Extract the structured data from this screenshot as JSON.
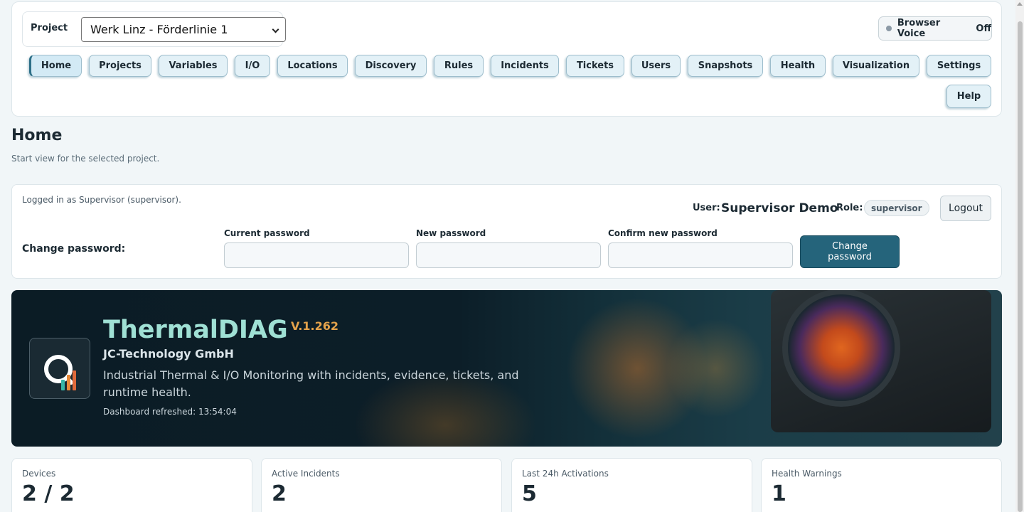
{
  "header": {
    "project_label": "Project",
    "project_value": "Werk Linz - Förderlinie 1",
    "voice_label": "Browser Voice",
    "voice_state": "Off"
  },
  "nav": {
    "items": [
      {
        "label": "Home"
      },
      {
        "label": "Projects"
      },
      {
        "label": "Variables"
      },
      {
        "label": "I/O"
      },
      {
        "label": "Locations"
      },
      {
        "label": "Discovery"
      },
      {
        "label": "Rules"
      },
      {
        "label": "Incidents"
      },
      {
        "label": "Tickets"
      },
      {
        "label": "Users"
      },
      {
        "label": "Snapshots"
      },
      {
        "label": "Health"
      },
      {
        "label": "Visualization"
      },
      {
        "label": "Settings"
      },
      {
        "label": "Help"
      }
    ],
    "active": "Home"
  },
  "page": {
    "title": "Home",
    "subtitle": "Start view for the selected project."
  },
  "account": {
    "logged_in_text": "Logged in as Supervisor (supervisor).",
    "user_label": "User:",
    "user_name": "Supervisor Demo",
    "role_label": "Role:",
    "role_value": "supervisor",
    "logout_label": "Logout",
    "change_password_label": "Change password:",
    "current_password_label": "Current password",
    "new_password_label": "New password",
    "confirm_password_label": "Confirm new password",
    "change_password_button_line1": "Change",
    "change_password_button_line2": "password"
  },
  "hero": {
    "title": "ThermalDIAG",
    "version": "V.1.262",
    "company": "JC-Technology GmbH",
    "description": "Industrial Thermal & I/O Monitoring with incidents, evidence, tickets, and runtime health.",
    "refreshed": "Dashboard refreshed: 13:54:04"
  },
  "stats": [
    {
      "label": "Devices",
      "value": "2 / 2"
    },
    {
      "label": "Active Incidents",
      "value": "2"
    },
    {
      "label": "Last 24h Activations",
      "value": "5"
    },
    {
      "label": "Health Warnings",
      "value": "1"
    }
  ],
  "colors": {
    "accent": "#25647b",
    "hero_title": "#9fe0d4",
    "version": "#e4a24b"
  }
}
